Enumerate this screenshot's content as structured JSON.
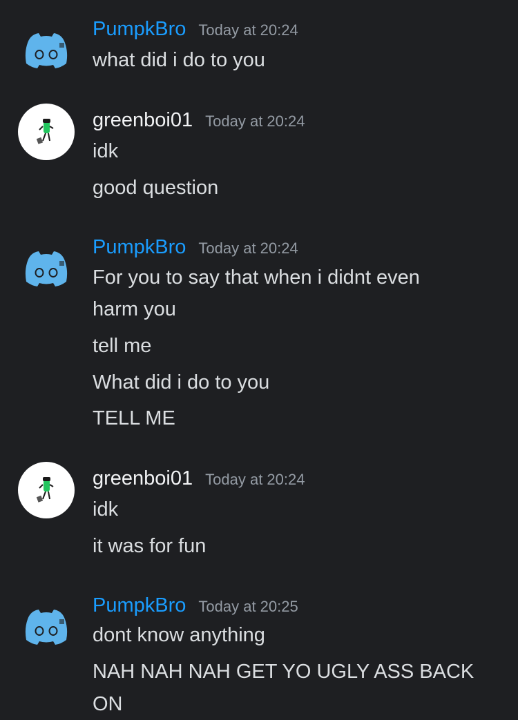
{
  "colors": {
    "background": "#1e1f22",
    "username_blue": "#1a9dff",
    "username_white": "#f2f3f5",
    "timestamp": "#949ba4",
    "message_text": "#dbdee1",
    "discord_avatar": "#5fb4ec"
  },
  "messages": [
    {
      "author": "PumpkBro",
      "avatar_icon": "discord-default-avatar-icon",
      "timestamp": "Today at 20:24",
      "lines": [
        "what did i do to you"
      ]
    },
    {
      "author": "greenboi01",
      "avatar_icon": "green-character-avatar-icon",
      "timestamp": "Today at 20:24",
      "lines": [
        "idk",
        "good question"
      ]
    },
    {
      "author": "PumpkBro",
      "avatar_icon": "discord-default-avatar-icon",
      "timestamp": "Today at 20:24",
      "lines": [
        "For you to say that when i didnt even",
        "harm you",
        "tell me",
        "What did i do to you",
        "TELL ME"
      ]
    },
    {
      "author": "greenboi01",
      "avatar_icon": "green-character-avatar-icon",
      "timestamp": "Today at 20:24",
      "lines": [
        "idk",
        "it was for fun"
      ]
    },
    {
      "author": "PumpkBro",
      "avatar_icon": "discord-default-avatar-icon",
      "timestamp": "Today at 20:25",
      "lines": [
        "dont know anything",
        "NAH NAH NAH GET YO UGLY ASS BACK",
        "ON"
      ]
    }
  ]
}
